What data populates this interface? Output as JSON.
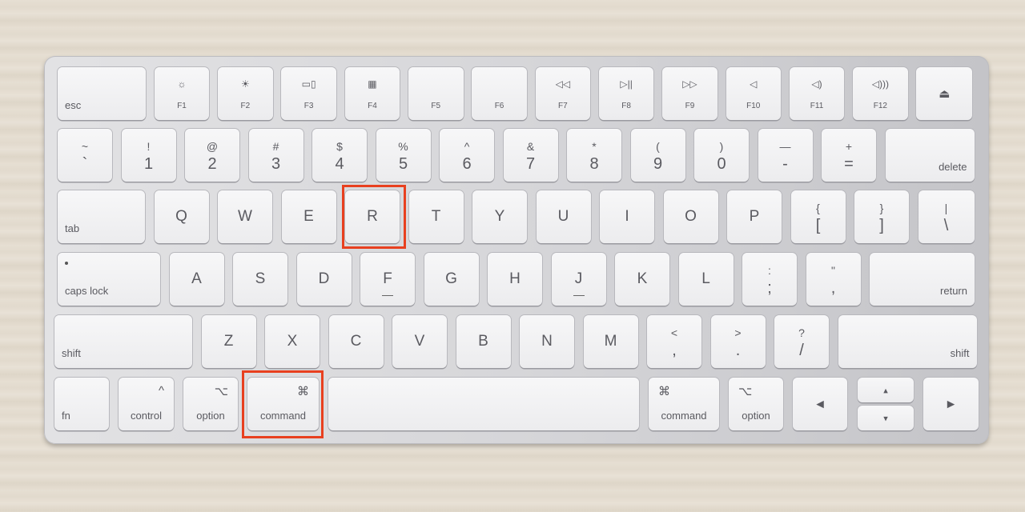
{
  "keyboard": {
    "rows": [
      [
        {
          "label": "esc"
        },
        {
          "icon": "brightness-low-icon",
          "fn": "F1"
        },
        {
          "icon": "brightness-high-icon",
          "fn": "F2"
        },
        {
          "icon": "mission-control-icon",
          "fn": "F3"
        },
        {
          "icon": "launchpad-icon",
          "fn": "F4"
        },
        {
          "fn": "F5"
        },
        {
          "fn": "F6"
        },
        {
          "icon": "rewind-icon",
          "fn": "F7"
        },
        {
          "icon": "play-pause-icon",
          "fn": "F8"
        },
        {
          "icon": "fast-forward-icon",
          "fn": "F9"
        },
        {
          "icon": "mute-icon",
          "fn": "F10"
        },
        {
          "icon": "volume-down-icon",
          "fn": "F11"
        },
        {
          "icon": "volume-up-icon",
          "fn": "F12"
        },
        {
          "icon": "eject-icon"
        }
      ],
      [
        {
          "top": "~",
          "bot": "`"
        },
        {
          "top": "!",
          "bot": "1"
        },
        {
          "top": "@",
          "bot": "2"
        },
        {
          "top": "#",
          "bot": "3"
        },
        {
          "top": "$",
          "bot": "4"
        },
        {
          "top": "%",
          "bot": "5"
        },
        {
          "top": "^",
          "bot": "6"
        },
        {
          "top": "&",
          "bot": "7"
        },
        {
          "top": "*",
          "bot": "8"
        },
        {
          "top": "(",
          "bot": "9"
        },
        {
          "top": ")",
          "bot": "0"
        },
        {
          "top": "—",
          "bot": "-"
        },
        {
          "top": "+",
          "bot": "="
        },
        {
          "labelRight": "delete"
        }
      ],
      [
        {
          "label": "tab"
        },
        {
          "main": "Q"
        },
        {
          "main": "W"
        },
        {
          "main": "E"
        },
        {
          "main": "R"
        },
        {
          "main": "T"
        },
        {
          "main": "Y"
        },
        {
          "main": "U"
        },
        {
          "main": "I"
        },
        {
          "main": "O"
        },
        {
          "main": "P"
        },
        {
          "top": "{",
          "bot": "["
        },
        {
          "top": "}",
          "bot": "]"
        },
        {
          "top": "|",
          "bot": "\\"
        }
      ],
      [
        {
          "label": "caps lock"
        },
        {
          "main": "A"
        },
        {
          "main": "S"
        },
        {
          "main": "D"
        },
        {
          "main": "F",
          "bump": true
        },
        {
          "main": "G"
        },
        {
          "main": "H"
        },
        {
          "main": "J",
          "bump": true
        },
        {
          "main": "K"
        },
        {
          "main": "L"
        },
        {
          "top": ":",
          "bot": ";"
        },
        {
          "top": "\"",
          "bot": ","
        },
        {
          "labelRight": "return"
        }
      ],
      [
        {
          "label": "shift"
        },
        {
          "main": "Z"
        },
        {
          "main": "X"
        },
        {
          "main": "C"
        },
        {
          "main": "V"
        },
        {
          "main": "B"
        },
        {
          "main": "N"
        },
        {
          "main": "M"
        },
        {
          "top": "<",
          "bot": ","
        },
        {
          "top": ">",
          "bot": "."
        },
        {
          "top": "?",
          "bot": "/"
        },
        {
          "labelRight": "shift"
        }
      ],
      [
        {
          "label": "fn"
        },
        {
          "labelCenter": "control",
          "sym": "^",
          "symSide": "right"
        },
        {
          "labelCenter": "option",
          "sym": "⌥",
          "symSide": "right"
        },
        {
          "labelCenter": "command",
          "sym": "⌘",
          "symSide": "right"
        },
        {
          "label": ""
        },
        {
          "labelCenter": "command",
          "sym": "⌘",
          "symSide": "left"
        },
        {
          "labelCenter": "option",
          "sym": "⌥",
          "symSide": "left"
        },
        {
          "main": "◂"
        },
        {
          "main": "▴"
        },
        {
          "main": "▾"
        },
        {
          "main": "▸"
        }
      ]
    ]
  },
  "highlights": [
    "R",
    "command-left"
  ],
  "colors": {
    "highlight": "#e8401f",
    "key": "#f2f2f4",
    "body": "#d4d4d7",
    "background": "#e4dccf"
  }
}
